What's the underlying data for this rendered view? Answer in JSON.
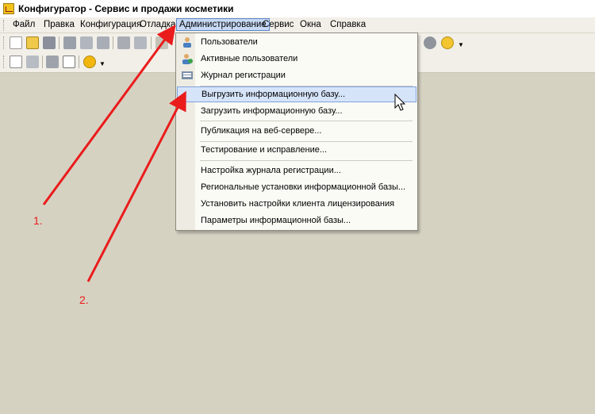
{
  "window": {
    "title": "Конфигуратор - Сервис и продажи косметики"
  },
  "menubar": {
    "items": [
      {
        "label": "Файл"
      },
      {
        "label": "Правка"
      },
      {
        "label": "Конфигурация"
      },
      {
        "label": "Отладка"
      },
      {
        "label": "Администрирование"
      },
      {
        "label": "Сервис"
      },
      {
        "label": "Окна"
      },
      {
        "label": "Справка"
      }
    ]
  },
  "admin_menu": {
    "items": [
      {
        "label": "Пользователи",
        "icon": "user-icon"
      },
      {
        "label": "Активные пользователи",
        "icon": "active-users-icon"
      },
      {
        "label": "Журнал регистрации",
        "icon": "log-icon"
      },
      {
        "label": "Выгрузить информационную базу...",
        "highlighted": true
      },
      {
        "label": "Загрузить информационную базу..."
      },
      {
        "label": "Публикация на веб-сервере..."
      },
      {
        "label": "Тестирование и исправление..."
      },
      {
        "label": "Настройка журнала регистрации..."
      },
      {
        "label": "Региональные установки информационной базы..."
      },
      {
        "label": "Установить настройки клиента лицензирования"
      },
      {
        "label": "Параметры информационной базы..."
      }
    ]
  },
  "annotations": {
    "step1": "1.",
    "step2": "2."
  },
  "colors": {
    "annotation": "#ea1c1c",
    "workspace": "#d6d2c2",
    "highlight": "#d6e4fa"
  }
}
